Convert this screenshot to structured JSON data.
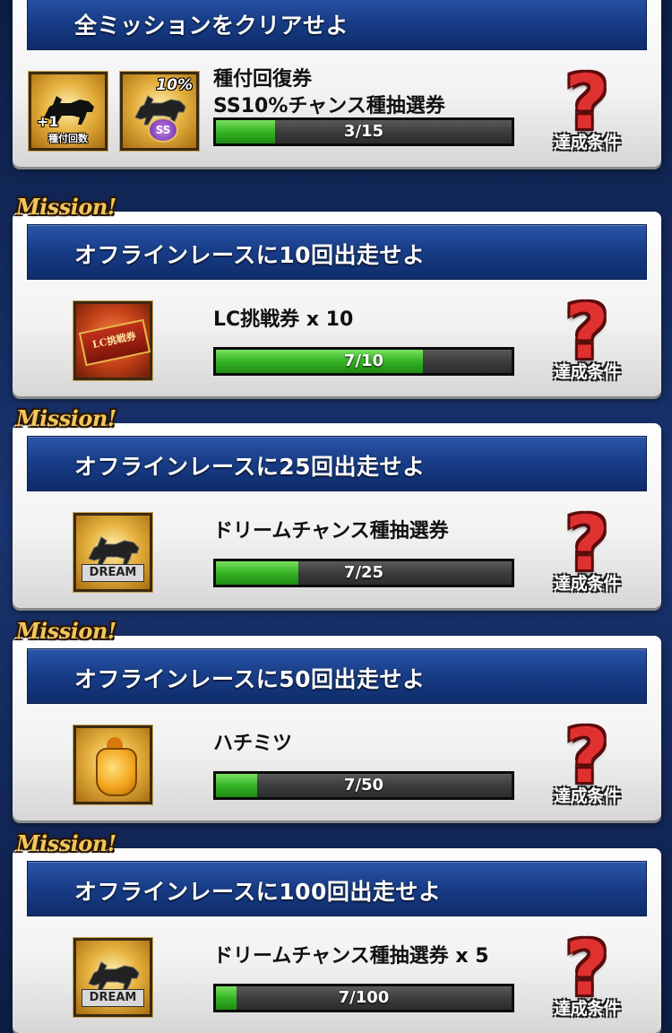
{
  "condition_label": "達成条件",
  "mission_tag": "Mission!",
  "missions": [
    {
      "title": "全ミッションをクリアせよ",
      "reward_lines": "種付回復券\nSS10%チャンス種抽選券",
      "progress_text": "3/15",
      "progress_fraction": 0.2,
      "icons": [
        {
          "kind": "breeding-recovery",
          "badge_plus": "+1",
          "badge_text": "種付回数"
        },
        {
          "kind": "ss-chance",
          "badge_text": "10%",
          "badge_ss": "SS"
        }
      ]
    },
    {
      "title": "オフラインレースに10回出走せよ",
      "reward_lines": "LC挑戦券 x 10",
      "progress_text": "7/10",
      "progress_fraction": 0.7,
      "icons": [
        {
          "kind": "lc-ticket",
          "badge_text": "LC挑戦券"
        }
      ]
    },
    {
      "title": "オフラインレースに25回出走せよ",
      "reward_lines": "ドリームチャンス種抽選券",
      "progress_text": "7/25",
      "progress_fraction": 0.28,
      "icons": [
        {
          "kind": "dream",
          "badge_text": "DREAM"
        }
      ]
    },
    {
      "title": "オフラインレースに50回出走せよ",
      "reward_lines": "ハチミツ",
      "progress_text": "7/50",
      "progress_fraction": 0.14,
      "icons": [
        {
          "kind": "honey"
        }
      ]
    },
    {
      "title": "オフラインレースに100回出走せよ",
      "reward_lines": "ドリームチャンス種抽選券 x 5",
      "progress_text": "7/100",
      "progress_fraction": 0.07,
      "icons": [
        {
          "kind": "dream",
          "badge_text": "DREAM"
        }
      ]
    }
  ]
}
